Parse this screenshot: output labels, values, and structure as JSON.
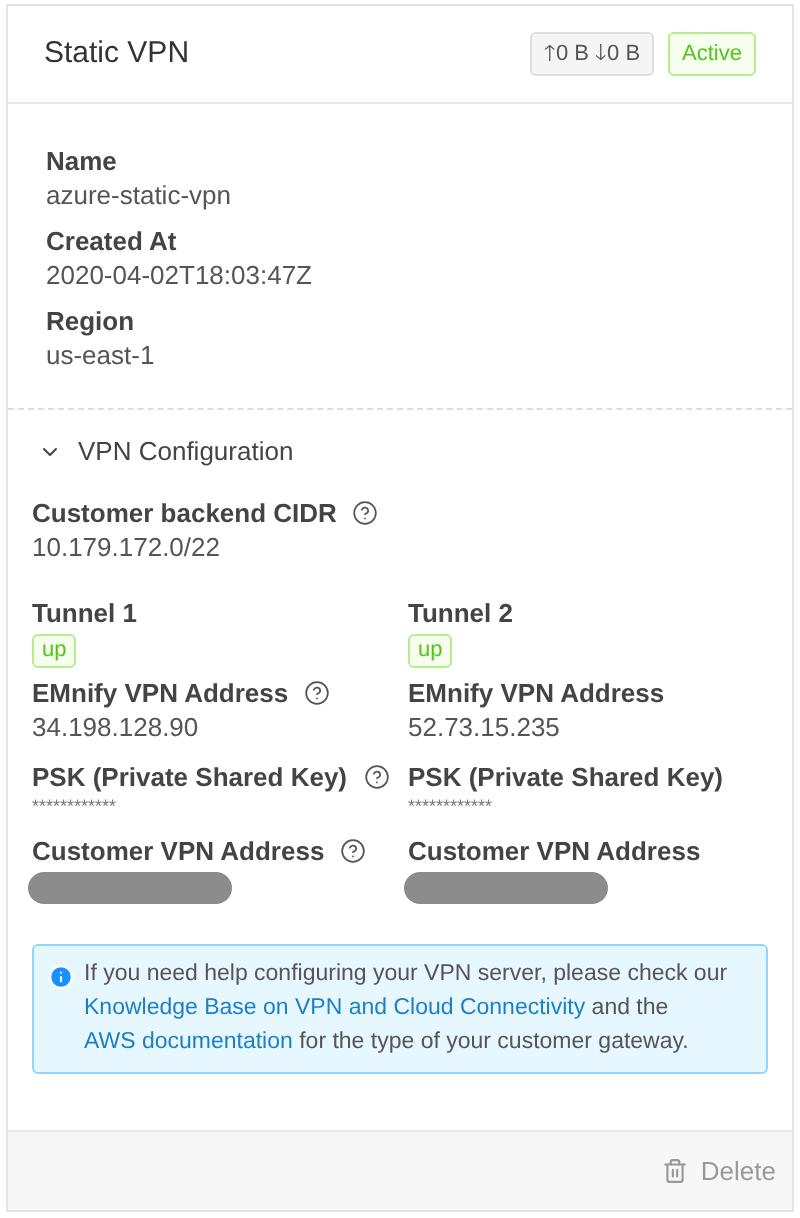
{
  "header": {
    "title": "Static VPN",
    "traffic": {
      "up_arrow": "🡑",
      "up": "0 B",
      "down_arrow": "🡓",
      "down": "0 B"
    },
    "status": "Active"
  },
  "details": [
    {
      "label": "Name",
      "value": "azure-static-vpn"
    },
    {
      "label": "Created At",
      "value": "2020-04-02T18:03:47Z"
    },
    {
      "label": "Region",
      "value": "us-east-1"
    }
  ],
  "config": {
    "title": "VPN Configuration",
    "expanded": true,
    "cidr": {
      "label": "Customer backend CIDR",
      "help": true,
      "value": "10.179.172.0/22"
    },
    "tunnels": [
      {
        "title": "Tunnel 1",
        "status": "up",
        "fields": [
          {
            "label": "EMnify VPN Address",
            "help": true,
            "kind": "text",
            "value": "34.198.128.90"
          },
          {
            "label": "PSK (Private Shared Key)",
            "help": true,
            "kind": "secret",
            "value": "************"
          },
          {
            "label": "Customer VPN Address",
            "help": true,
            "kind": "redacted"
          }
        ]
      },
      {
        "title": "Tunnel 2",
        "status": "up",
        "fields": [
          {
            "label": "EMnify VPN Address",
            "help": false,
            "kind": "text",
            "value": "52.73.15.235"
          },
          {
            "label": "PSK (Private Shared Key)",
            "help": false,
            "kind": "secret",
            "value": "************"
          },
          {
            "label": "Customer VPN Address",
            "help": false,
            "kind": "redacted"
          }
        ]
      }
    ],
    "info": [
      {
        "kind": "text",
        "text": "If you need help configuring your VPN server, please check our "
      },
      {
        "kind": "link",
        "text": "Knowledge Base on VPN and Cloud Connectivity"
      },
      {
        "kind": "text",
        "text": " and the "
      },
      {
        "kind": "link",
        "text": "AWS documentation"
      },
      {
        "kind": "text",
        "text": " for the type of your customer gateway."
      }
    ]
  },
  "footer": {
    "delete": "Delete"
  }
}
